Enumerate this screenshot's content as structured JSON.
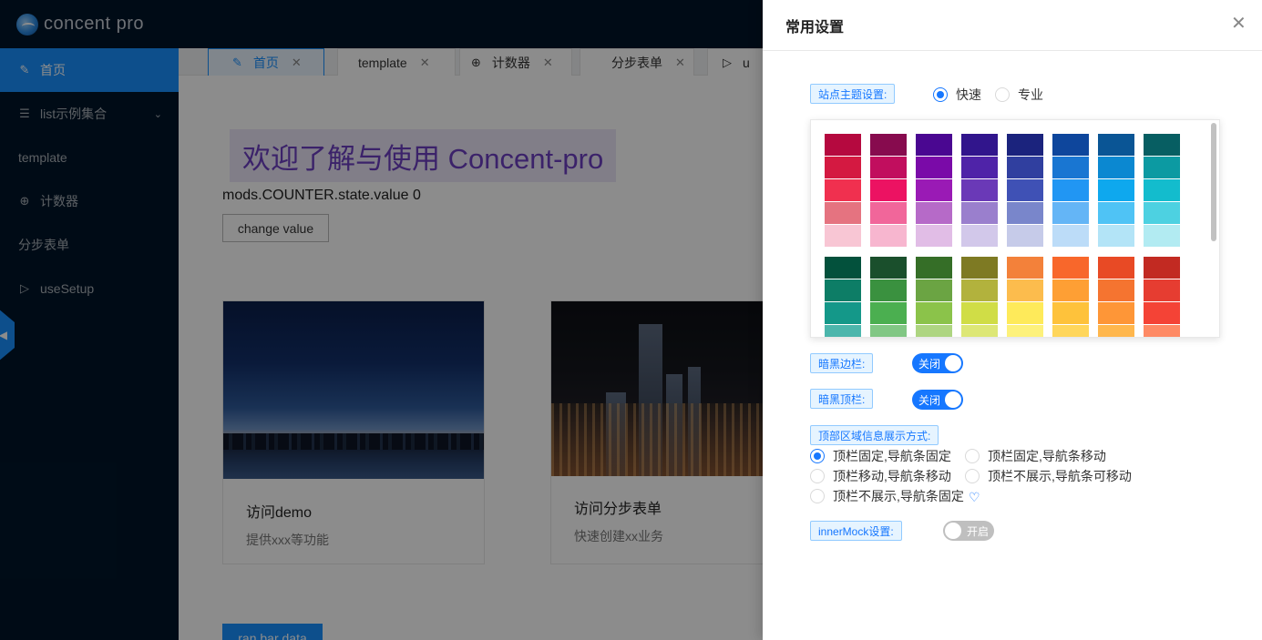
{
  "app": {
    "logo_text": "concent pro",
    "sidebar": {
      "items": [
        {
          "label": "首页",
          "icon": "edit-icon"
        },
        {
          "label": "list示例集合",
          "icon": "list-icon"
        },
        {
          "label": "template",
          "icon": ""
        },
        {
          "label": "计数器",
          "icon": "plus-circle-icon"
        },
        {
          "label": "分步表单",
          "icon": ""
        },
        {
          "label": "useSetup",
          "icon": "play-circle-icon"
        }
      ]
    },
    "tabs": [
      {
        "label": "首页",
        "icon": "edit-icon"
      },
      {
        "label": "template",
        "icon": ""
      },
      {
        "label": "计数器",
        "icon": "plus-circle-icon"
      },
      {
        "label": "分步表单",
        "icon": ""
      },
      {
        "label": "u",
        "icon": "play-circle-icon"
      }
    ],
    "main": {
      "welcome": "欢迎了解与使用 Concent-pro",
      "state_line": "mods.COUNTER.state.value 0",
      "change_button": "change value",
      "cards": [
        {
          "title": "访问demo",
          "desc": "提供xxx等功能"
        },
        {
          "title": "访问分步表单",
          "desc": "快速创建xx业务"
        }
      ],
      "bar_button": "ran bar data"
    }
  },
  "drawer": {
    "title": "常用设置",
    "close_icon": "close-icon",
    "theme": {
      "label": "站点主题设置:",
      "options": [
        "快速",
        "专业"
      ],
      "selected": "快速"
    },
    "palette": {
      "rows": [
        {
          "columns": [
            [
              "#b5093f",
              "#d41941",
              "#f0304f",
              "#e57380",
              "#f8c6d4"
            ],
            [
              "#870b4e",
              "#c10e5e",
              "#ec1262",
              "#f1669a",
              "#f7b6cf"
            ],
            [
              "#4a0791",
              "#7a0aa8",
              "#9a1ab5",
              "#b66ac8",
              "#e1bde6"
            ],
            [
              "#31158c",
              "#4f23a8",
              "#6a39b7",
              "#9a7fcd",
              "#d2c8ea"
            ],
            [
              "#1b237d",
              "#303f9f",
              "#3f51b5",
              "#7986cb",
              "#c6cbe9"
            ],
            [
              "#0e469c",
              "#1976d2",
              "#2196f3",
              "#64b5f6",
              "#bcdcf8"
            ],
            [
              "#0a5595",
              "#0b88d1",
              "#0ea8ee",
              "#4fc3f5",
              "#b3e4f7"
            ],
            [
              "#075e62",
              "#0c9aa2",
              "#13bccd",
              "#4dd1e1",
              "#b2ebf2"
            ]
          ]
        },
        {
          "columns": [
            [
              "#03513c",
              "#0d7d66",
              "#149889",
              "#4cb6ac"
            ],
            [
              "#1a4f2c",
              "#3a913f",
              "#4baf50",
              "#81c784"
            ],
            [
              "#356e27",
              "#6ba443",
              "#8bc34a",
              "#aed581"
            ],
            [
              "#7e7a23",
              "#b2b23d",
              "#d0dd46",
              "#dde776"
            ],
            [
              "#f3813a",
              "#fcbc4d",
              "#feea5a",
              "#fdf17b"
            ],
            [
              "#f8672b",
              "#fe9f34",
              "#fec23b",
              "#ffd65b"
            ],
            [
              "#e84a25",
              "#f57430",
              "#fe9637",
              "#ffb74d"
            ],
            [
              "#c22a22",
              "#e63d31",
              "#f44336",
              "#fe8a65"
            ]
          ]
        }
      ]
    },
    "dark_sider": {
      "label": "暗黑边栏:",
      "state": "关闭"
    },
    "dark_header": {
      "label": "暗黑顶栏:",
      "state": "关闭"
    },
    "top_display": {
      "label": "顶部区域信息展示方式:",
      "options": [
        "顶栏固定,导航条固定",
        "顶栏固定,导航条移动",
        "顶栏移动,导航条移动",
        "顶栏不展示,导航条可移动",
        "顶栏不展示,导航条固定"
      ],
      "selected": "顶栏固定,导航条固定",
      "extra_icon": "heart-icon"
    },
    "inner_mock": {
      "label": "innerMock设置:",
      "state": "开启"
    }
  },
  "colors": {
    "primary": "#1677ff",
    "sider_bg": "#001529",
    "welcome_text": "#6c3ec1"
  }
}
